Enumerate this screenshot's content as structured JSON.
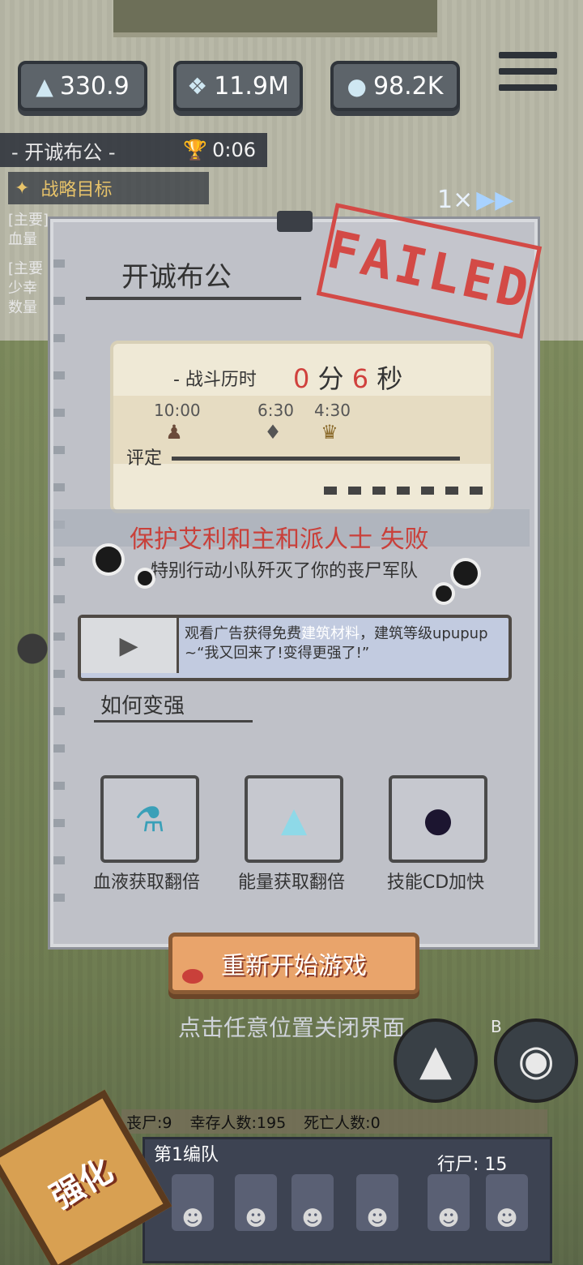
{
  "resources": {
    "energy": {
      "icon": "energy-crystal-icon",
      "value": "330.9"
    },
    "blood": {
      "icon": "blood-drops-icon",
      "value": "11.9M"
    },
    "material": {
      "icon": "stone-material-icon",
      "value": "98.2K"
    }
  },
  "hud": {
    "mission_title": "- 开诚布公 -",
    "mission_time": "0:06",
    "objective_label": "战略目标",
    "side_text_1": "[主要]",
    "side_text_2": "血量",
    "side_text_3": "[主要",
    "side_text_4": "少幸",
    "side_text_5": "数量",
    "speed": "1×"
  },
  "panel": {
    "title": "开诚布公",
    "stamp": "FAILED",
    "duration_label": "- 战斗历时",
    "minutes": "0",
    "minutes_unit": "分",
    "seconds": "6",
    "seconds_unit": "秒",
    "rating_label": "评定",
    "ticks": [
      "10:00",
      "6:30",
      "4:30"
    ],
    "fail_title": "保护艾利和主和派人士 失败",
    "fail_subtitle": "特别行动小队歼灭了你的丧尸军队"
  },
  "ad": {
    "line1_prefix": "观看广告获得免费",
    "line1_highlight": "建筑材料",
    "line1_suffix": "，建筑等级upupup",
    "line2": "~“我又回来了!变得更强了!”"
  },
  "tips": {
    "heading": "如何变强",
    "items": [
      {
        "icon": "blood-potion-icon",
        "label": "血液获取翻倍"
      },
      {
        "icon": "energy-crystal-icon",
        "label": "能量获取翻倍"
      },
      {
        "icon": "skill-cooldown-icon",
        "label": "技能CD加快"
      }
    ]
  },
  "actions": {
    "restart": "重新开始游戏",
    "close_hint": "点击任意位置关闭界面"
  },
  "stats": {
    "zombies": "丧尸:9",
    "survivors": "幸存人数:195",
    "deaths": "死亡人数:0"
  },
  "squad": {
    "name": "第1编队",
    "walkers": "行尸: 15"
  },
  "buttons": {
    "strengthen": "强化",
    "skill_b_key": "B"
  }
}
